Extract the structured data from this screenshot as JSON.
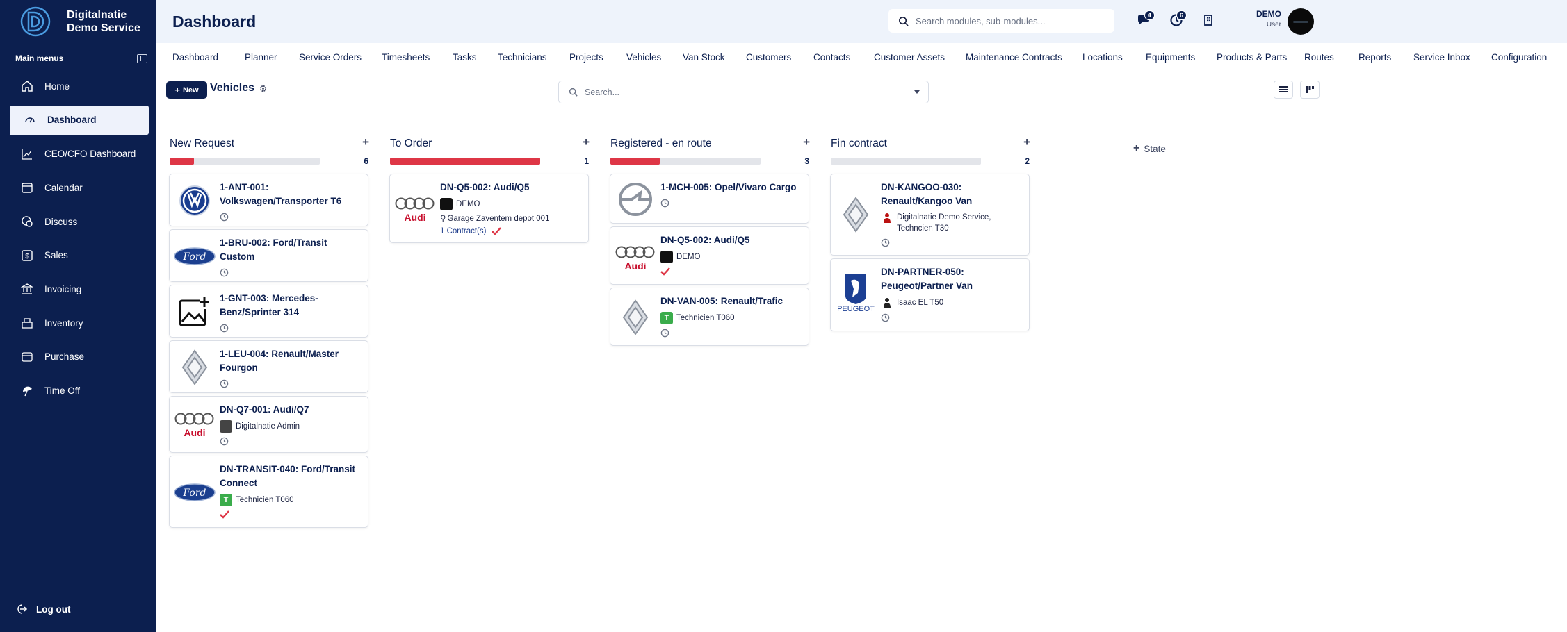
{
  "app": {
    "brand_line1": "Digitalnatie",
    "brand_line2": "Demo Service"
  },
  "sidebar": {
    "menus_label": "Main menus",
    "items": [
      {
        "label": "Home",
        "icon": "home-icon",
        "active": false
      },
      {
        "label": "Dashboard",
        "icon": "dashboard-gauge-icon",
        "active": true
      },
      {
        "label": "CEO/CFO Dashboard",
        "icon": "chart-line-icon",
        "active": false
      },
      {
        "label": "Calendar",
        "icon": "calendar-icon",
        "active": false
      },
      {
        "label": "Discuss",
        "icon": "discuss-icon",
        "active": false
      },
      {
        "label": "Sales",
        "icon": "sales-icon",
        "active": false
      },
      {
        "label": "Invoicing",
        "icon": "invoicing-icon",
        "active": false
      },
      {
        "label": "Inventory",
        "icon": "inventory-icon",
        "active": false
      },
      {
        "label": "Purchase",
        "icon": "purchase-icon",
        "active": false
      },
      {
        "label": "Time Off",
        "icon": "time-off-icon",
        "active": false
      }
    ],
    "logout_label": "Log out"
  },
  "header": {
    "title": "Dashboard",
    "search_placeholder": "Search modules, sub-modules...",
    "messages_badge": "4",
    "activities_badge": "6",
    "user_name": "DEMO",
    "user_role": "User"
  },
  "nav": {
    "items": [
      "Dashboard",
      "Planner",
      "Service Orders",
      "Timesheets",
      "Tasks",
      "Technicians",
      "Projects",
      "Vehicles",
      "Van Stock",
      "Customers",
      "Contacts",
      "Customer Assets",
      "Maintenance Contracts",
      "Locations",
      "Equipments",
      "Products & Parts",
      "Routes",
      "Reports",
      "Service Inbox",
      "Configuration"
    ]
  },
  "controls": {
    "new_label": "New",
    "view_title": "Vehicles",
    "search_placeholder": "Search..."
  },
  "board": {
    "add_state_label": "State",
    "columns": [
      {
        "title": "New Request",
        "count": "6",
        "progress": 0.16,
        "cards": [
          {
            "title": "1-ANT-001: Volkswagen/Transporter T6",
            "logo": "volkswagen-logo"
          },
          {
            "title": "1-BRU-002: Ford/Transit Custom",
            "logo": "ford-logo"
          },
          {
            "title": "1-GNT-003: Mercedes-Benz/Sprinter 314",
            "logo": "add-image-placeholder"
          },
          {
            "title": "1-LEU-004: Renault/Master Fourgon",
            "logo": "renault-logo"
          },
          {
            "title": "DN-Q7-001: Audi/Q7",
            "logo": "audi-logo",
            "person": "Digitalnatie Admin"
          },
          {
            "title": "DN-TRANSIT-040: Ford/Transit Connect",
            "logo": "ford-logo",
            "person": "Technicien T060",
            "checked": true
          }
        ]
      },
      {
        "title": "To Order",
        "count": "1",
        "progress": 1.0,
        "cards": [
          {
            "title": "DN-Q5-002: Audi/Q5",
            "logo": "audi-logo",
            "person": "DEMO",
            "location": "Garage Zaventem depot 001",
            "contracts": "1 Contract(s)",
            "checked": true
          }
        ]
      },
      {
        "title": "Registered - en route",
        "count": "3",
        "progress": 0.33,
        "cards": [
          {
            "title": "1-MCH-005: Opel/Vivaro Cargo",
            "logo": "opel-logo"
          },
          {
            "title": "DN-Q5-002: Audi/Q5",
            "logo": "audi-logo",
            "person": "DEMO",
            "checked": true
          },
          {
            "title": "DN-VAN-005: Renault/Trafic",
            "logo": "renault-logo",
            "person": "Technicien T060"
          }
        ]
      },
      {
        "title": "Fin contract",
        "count": "2",
        "progress": 0.0,
        "cards": [
          {
            "title": "DN-KANGOO-030: Renault/Kangoo Van",
            "logo": "renault-logo",
            "person": "Digitalnatie Demo Service, Techncien T30"
          },
          {
            "title": "DN-PARTNER-050: Peugeot/Partner Van",
            "logo": "peugeot-logo",
            "person": "Isaac EL T50"
          }
        ]
      }
    ]
  },
  "colors": {
    "sidebar_bg": "#0c1f4f",
    "accent_red": "#de3646",
    "header_bg": "#eef3fb",
    "tech_badge": "#3aac4b"
  }
}
